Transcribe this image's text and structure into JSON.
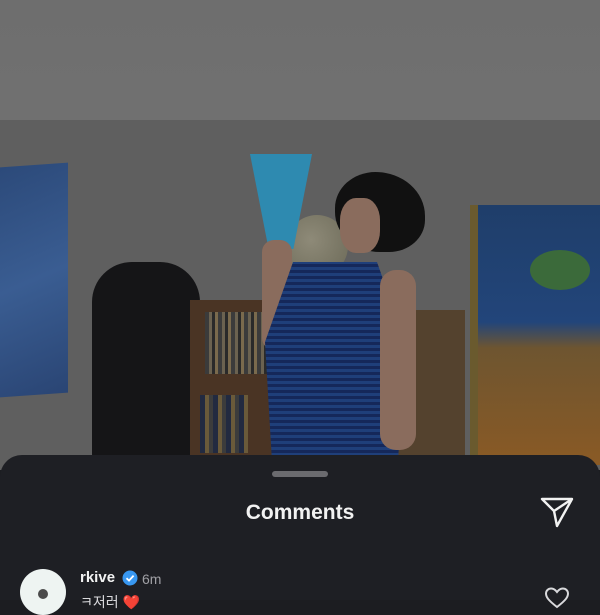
{
  "sheet": {
    "title": "Comments",
    "send_icon": "send-icon"
  },
  "comments": [
    {
      "username": "rkive",
      "verified": true,
      "time": "6m",
      "text": "ㅋ저러 ❤️",
      "like_icon": "heart-outline-icon"
    }
  ],
  "colors": {
    "sheet_bg": "#1e1f24",
    "verified_blue": "#3897f0"
  }
}
